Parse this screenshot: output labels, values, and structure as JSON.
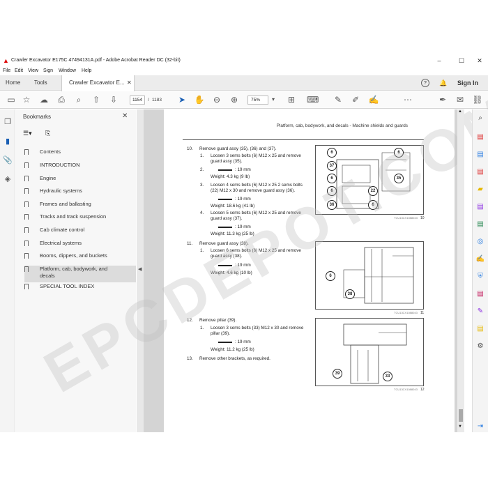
{
  "window": {
    "title": "Crawler Excavator E175C 47494131A.pdf - Adobe Acrobat Reader DC (32-bit)",
    "controls": [
      "–",
      "☐",
      "✕"
    ]
  },
  "menu": [
    "File",
    "Edit",
    "View",
    "Sign",
    "Window",
    "Help"
  ],
  "tabs": {
    "home": "Home",
    "tools": "Tools",
    "doc": "Crawler Excavator E...",
    "doc_close": "✕",
    "help": "?",
    "sign_in": "Sign In"
  },
  "toolbar": {
    "page_current": "1154",
    "page_sep": "/",
    "page_total": "1183",
    "zoom": "75%"
  },
  "bookmarks": {
    "header": "Bookmarks",
    "close": "✕",
    "items": [
      "Contents",
      "INTRODUCTION",
      "Engine",
      "Hydraulic systems",
      "Frames and ballasting",
      "Tracks and track suspension",
      "Cab climate control",
      "Electrical systems",
      "Booms, dippers, and buckets",
      "Platform, cab, bodywork, and decals",
      "SPECIAL TOOL INDEX"
    ],
    "selected_index": 9
  },
  "document": {
    "header": "Platform, cab, bodywork, and decals - Machine shields and guards",
    "steps": [
      {
        "num": "10.",
        "text": "Remove guard assy (35), (36) and (37)."
      },
      {
        "num": "1.",
        "text": "Loosen 3 sems bolts (6) M12 x 25 and remove guard assy (35)."
      },
      {
        "num": "2.",
        "text": ": 19 mm"
      },
      {
        "num": "",
        "text": "Weight: 4.3 kg (9 lb)"
      },
      {
        "num": "3.",
        "text": "Loosen 4 sems bolts (6) M12 x 25 2 sems bolts (22) M12 x 30 and remove guard assy (36)."
      },
      {
        "num": "",
        "text": ": 19 mm"
      },
      {
        "num": "",
        "text": "Weight: 18.6 kg (41 lb)"
      },
      {
        "num": "4.",
        "text": "Loosen 5 sems bolts (6) M12 x 25 and remove guard assy (37)."
      },
      {
        "num": "",
        "text": ": 19 mm"
      },
      {
        "num": "",
        "text": "Weight: 11.3 kg (25 lb)"
      },
      {
        "num": "11.",
        "text": "Remove guard assy (38)."
      },
      {
        "num": "1.",
        "text": "Loosen 6 sems bolts (6) M12 x 25 and remove guard assy (38)."
      },
      {
        "num": "",
        "text": ": 19 mm"
      },
      {
        "num": "",
        "text": "Weight: 4.6 kg (10 lb)"
      },
      {
        "num": "12.",
        "text": "Remove pillar (39)."
      },
      {
        "num": "1.",
        "text": "Loosen 3 sems bolts (33) M12 x 30 and remove pillar (39)."
      },
      {
        "num": "",
        "text": ": 19 mm"
      },
      {
        "num": "",
        "text": "Weight: 11.2 kg (25 lb)"
      },
      {
        "num": "13.",
        "text": "Remove other brackets, as required."
      }
    ],
    "fig1_callouts": [
      "6",
      "37",
      "6",
      "6",
      "36",
      "6",
      "35",
      "22",
      "6"
    ],
    "fig1_caption": "TCU13CX1088043",
    "fig1_num": "10",
    "fig2_callouts": [
      "6",
      "38"
    ],
    "fig2_caption": "TCU13CX1088043",
    "fig2_num": "11",
    "fig3_callouts": [
      "39",
      "33"
    ],
    "fig3_caption": "TCU13CX1088043",
    "fig3_num": "12"
  },
  "watermark": "EPCDEPOT.COM"
}
